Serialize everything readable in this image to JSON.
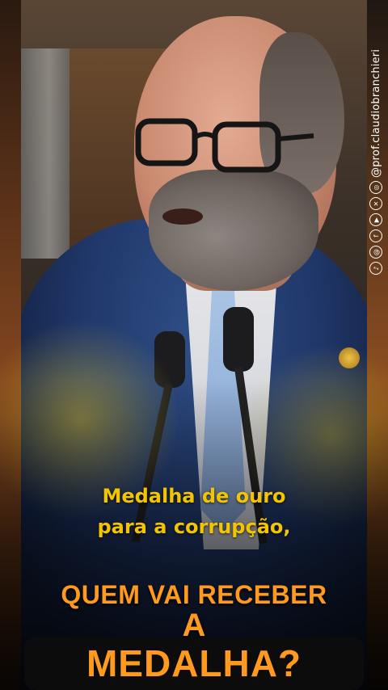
{
  "overlay": {
    "handle": "@prof.claudiobranchieri",
    "social_icons": [
      "tiktok-icon",
      "threads-icon",
      "facebook-icon",
      "youtube-icon",
      "x-icon",
      "instagram-icon"
    ]
  },
  "captions": {
    "line1": "Medalha de ouro",
    "line2": "para a corrupção,"
  },
  "banner": {
    "top": "QUEM VAI RECEBER",
    "middle": "A",
    "main": "MEDALHA?"
  },
  "colors": {
    "subtitle": "#f2c500",
    "banner_text": "#ff9a1f",
    "banner_box": "#0c0c0c"
  }
}
